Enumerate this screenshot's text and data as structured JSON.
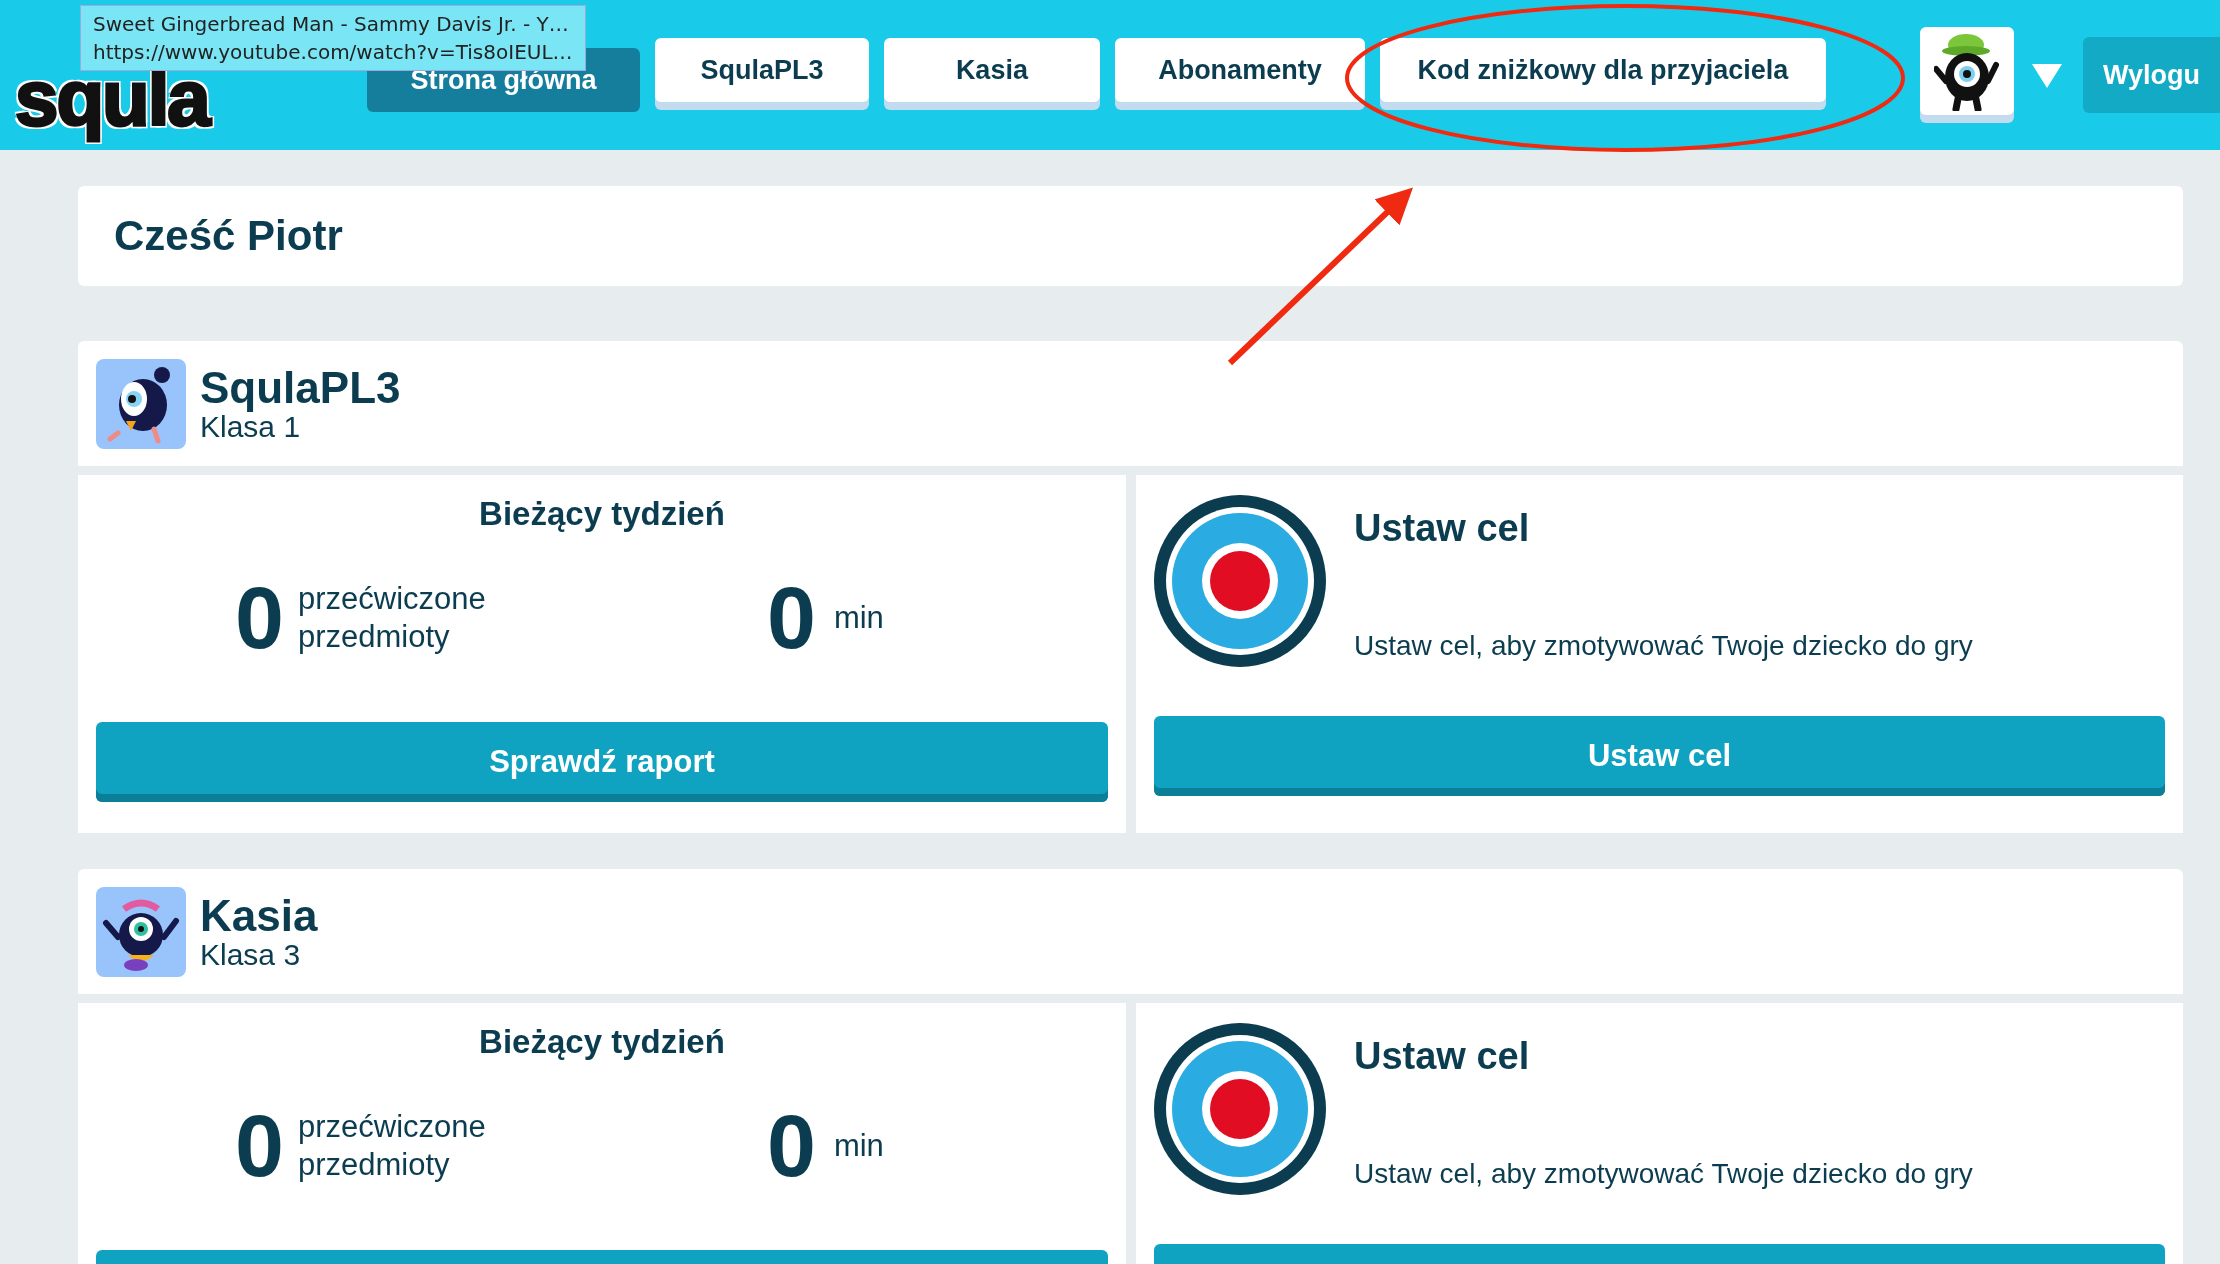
{
  "header": {
    "logo": "squla",
    "nav": [
      {
        "label": "Strona główna",
        "selected": true
      },
      {
        "label": "SqulaPL3",
        "selected": false
      },
      {
        "label": "Kasia",
        "selected": false
      },
      {
        "label": "Abonamenty",
        "selected": false
      },
      {
        "label": "Kod zniżkowy dla przyjaciela",
        "selected": false
      }
    ],
    "logout": "Wylogu"
  },
  "tooltip": {
    "title": "Sweet Gingerbread Man - Sammy Davis Jr. - Y…",
    "url": "https://www.youtube.com/watch?v=Tis8oIEUL…"
  },
  "greeting": "Cześć Piotr",
  "children": [
    {
      "name": "SqulaPL3",
      "grade": "Klasa 1",
      "kind": "bird",
      "week_title": "Bieżący tydzień",
      "subjects_count": "0",
      "subjects_label": "przećwiczone przedmioty",
      "minutes_count": "0",
      "minutes_unit": "min",
      "report_button": "Sprawdź raport",
      "goal_title": "Ustaw cel",
      "goal_description": "Ustaw cel, aby zmotywować Twoje dziecko do gry",
      "goal_button": "Ustaw cel"
    },
    {
      "name": "Kasia",
      "grade": "Klasa 3",
      "kind": "monster",
      "week_title": "Bieżący tydzień",
      "subjects_count": "0",
      "subjects_label": "przećwiczone przedmioty",
      "minutes_count": "0",
      "minutes_unit": "min",
      "goal_title": "Ustaw cel",
      "goal_description": "Ustaw cel, aby zmotywować Twoje dziecko do gry"
    }
  ]
}
